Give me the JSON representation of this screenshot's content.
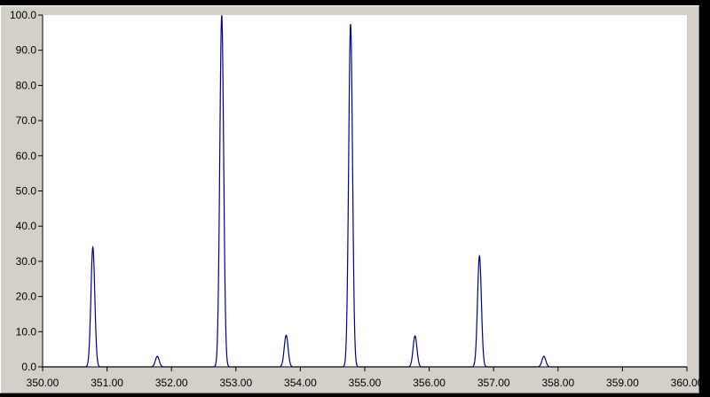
{
  "chart_data": {
    "type": "line",
    "title": "",
    "xlabel": "",
    "ylabel": "",
    "xlim": [
      350.0,
      360.0
    ],
    "ylim": [
      0.0,
      100.0
    ],
    "x_ticks": [
      "350.00",
      "351.00",
      "352.00",
      "353.00",
      "354.00",
      "355.00",
      "356.00",
      "357.00",
      "358.00",
      "359.00",
      "360.00"
    ],
    "y_ticks": [
      "0.0",
      "10.0",
      "20.0",
      "30.0",
      "40.0",
      "50.0",
      "60.0",
      "70.0",
      "80.0",
      "90.0",
      "100.0"
    ],
    "grid": false,
    "legend": "none",
    "line_color": "#00008b",
    "plot_background": "#ffffff",
    "peaks": [
      {
        "x": 350.78,
        "y": 34.0
      },
      {
        "x": 351.78,
        "y": 3.0
      },
      {
        "x": 352.78,
        "y": 100.0
      },
      {
        "x": 353.78,
        "y": 9.0
      },
      {
        "x": 354.78,
        "y": 97.5
      },
      {
        "x": 355.78,
        "y": 8.8
      },
      {
        "x": 356.78,
        "y": 31.5
      },
      {
        "x": 357.78,
        "y": 3.0
      }
    ],
    "peak_width": 0.03
  }
}
